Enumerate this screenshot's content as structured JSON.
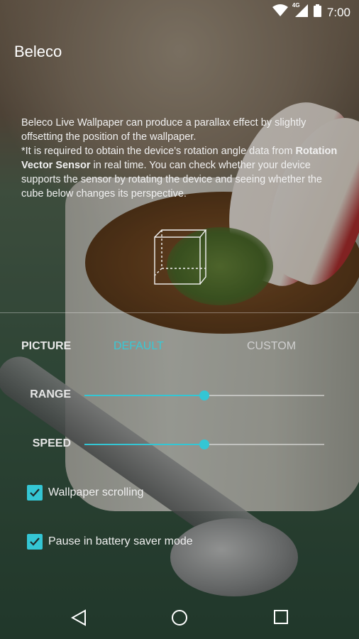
{
  "status_bar": {
    "time": "7:00",
    "network_label": "4G",
    "icons": [
      "wifi-icon",
      "cell-signal-icon",
      "battery-icon"
    ]
  },
  "app": {
    "title": "Beleco"
  },
  "description": {
    "line1": "Beleco Live Wallpaper can produce a parallax effect by slightly offsetting the position of the wallpaper.",
    "line2_prefix": "*It is required to obtain the device's rotation angle data from ",
    "line2_bold": "Rotation Vector Sensor",
    "line2_suffix": " in real time. You can check whether your device supports the sensor by rotating the device and seeing whether the cube below changes its perspective."
  },
  "picture": {
    "label": "PICTURE",
    "options": [
      "DEFAULT",
      "CUSTOM"
    ],
    "selected": "DEFAULT"
  },
  "sliders": {
    "range": {
      "label": "RANGE",
      "value": 0.5
    },
    "speed": {
      "label": "SPEED",
      "value": 0.5
    }
  },
  "checkboxes": {
    "wallpaper_scrolling": {
      "label": "Wallpaper scrolling",
      "checked": true
    },
    "pause_battery_saver": {
      "label": "Pause in battery saver mode",
      "checked": true
    }
  },
  "nav": {
    "icons": [
      "back-icon",
      "home-icon",
      "recents-icon"
    ]
  },
  "colors": {
    "accent": "#34c6d4"
  }
}
